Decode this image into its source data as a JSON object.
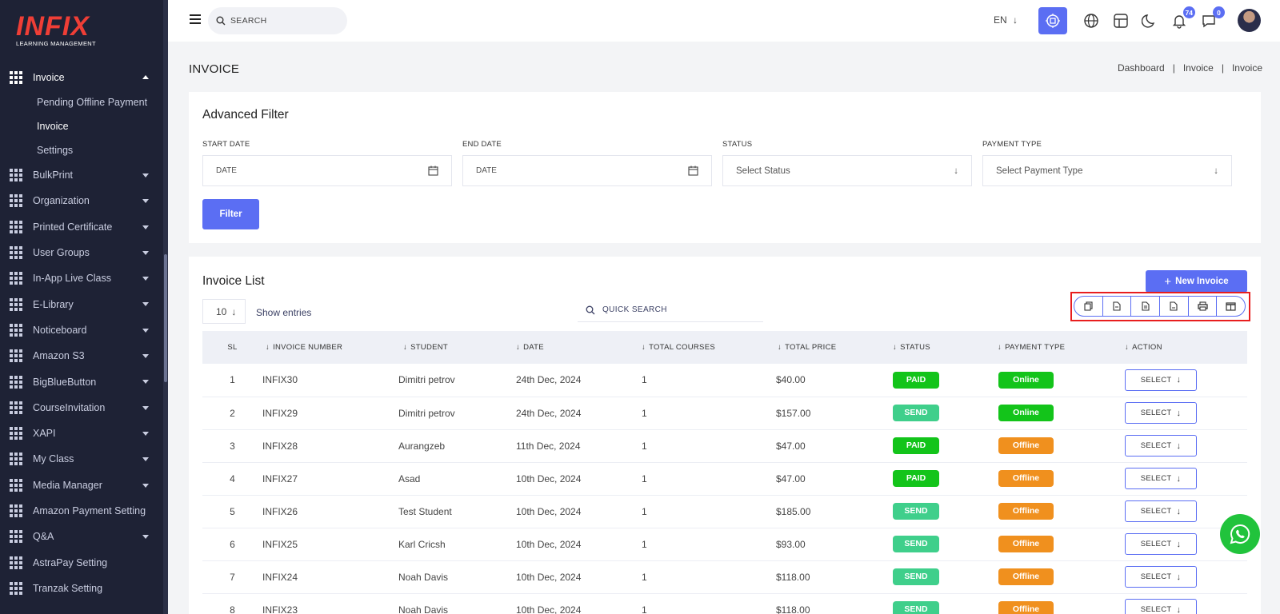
{
  "brand": {
    "name": "INFIX",
    "tagline": "LEARNING MANAGEMENT"
  },
  "sidebar": {
    "active": {
      "label": "Invoice",
      "icon": "grid-icon"
    },
    "submenu": [
      "Pending Offline Payment",
      "Invoice",
      "Settings"
    ],
    "items": [
      {
        "label": "BulkPrint",
        "caret": true
      },
      {
        "label": "Organization",
        "caret": true
      },
      {
        "label": "Printed Certificate",
        "caret": true
      },
      {
        "label": "User Groups",
        "caret": true
      },
      {
        "label": "In-App Live Class",
        "caret": true
      },
      {
        "label": "E-Library",
        "caret": true
      },
      {
        "label": "Noticeboard",
        "caret": true
      },
      {
        "label": "Amazon S3",
        "caret": true
      },
      {
        "label": "BigBlueButton",
        "caret": true
      },
      {
        "label": "CourseInvitation",
        "caret": true
      },
      {
        "label": "XAPI",
        "caret": true
      },
      {
        "label": "My Class",
        "caret": true
      },
      {
        "label": "Media Manager",
        "caret": true
      },
      {
        "label": "Amazon Payment Setting",
        "caret": false
      },
      {
        "label": "Q&A",
        "caret": true
      },
      {
        "label": "AstraPay Setting",
        "caret": false
      },
      {
        "label": "Tranzak Setting",
        "caret": false
      }
    ]
  },
  "header": {
    "search_placeholder": "SEARCH",
    "language": "EN",
    "notifications_count": "74",
    "messages_count": "0"
  },
  "page": {
    "title": "INVOICE",
    "breadcrumb": [
      "Dashboard",
      "Invoice",
      "Invoice"
    ]
  },
  "filter": {
    "title": "Advanced Filter",
    "start_date": {
      "label": "START DATE",
      "placeholder": "DATE"
    },
    "end_date": {
      "label": "END DATE",
      "placeholder": "DATE"
    },
    "status": {
      "label": "STATUS",
      "value": "Select Status"
    },
    "payment_type": {
      "label": "PAYMENT TYPE",
      "value": "Select Payment Type"
    },
    "button": "Filter"
  },
  "list": {
    "title": "Invoice List",
    "new_button": "New Invoice",
    "entries": "10",
    "show_entries": "Show entries",
    "quick_search_placeholder": "QUICK SEARCH",
    "export_icons": [
      "copy-icon",
      "csv-icon",
      "excel-icon",
      "pdf-icon",
      "print-icon",
      "columns-icon"
    ],
    "columns": [
      "SL",
      "INVOICE NUMBER",
      "STUDENT",
      "DATE",
      "TOTAL COURSES",
      "TOTAL PRICE",
      "STATUS",
      "PAYMENT TYPE",
      "ACTION"
    ],
    "action_label": "SELECT",
    "rows": [
      {
        "sl": "1",
        "invoice": "INFIX30",
        "student": "Dimitri petrov",
        "date": "24th Dec, 2024",
        "courses": "1",
        "price": "$40.00",
        "status": "PAID",
        "payment": "Online"
      },
      {
        "sl": "2",
        "invoice": "INFIX29",
        "student": "Dimitri petrov",
        "date": "24th Dec, 2024",
        "courses": "1",
        "price": "$157.00",
        "status": "SEND",
        "payment": "Online"
      },
      {
        "sl": "3",
        "invoice": "INFIX28",
        "student": "Aurangzeb",
        "date": "11th Dec, 2024",
        "courses": "1",
        "price": "$47.00",
        "status": "PAID",
        "payment": "Offline"
      },
      {
        "sl": "4",
        "invoice": "INFIX27",
        "student": "Asad",
        "date": "10th Dec, 2024",
        "courses": "1",
        "price": "$47.00",
        "status": "PAID",
        "payment": "Offline"
      },
      {
        "sl": "5",
        "invoice": "INFIX26",
        "student": "Test Student",
        "date": "10th Dec, 2024",
        "courses": "1",
        "price": "$185.00",
        "status": "SEND",
        "payment": "Offline"
      },
      {
        "sl": "6",
        "invoice": "INFIX25",
        "student": "Karl Cricsh",
        "date": "10th Dec, 2024",
        "courses": "1",
        "price": "$93.00",
        "status": "SEND",
        "payment": "Offline"
      },
      {
        "sl": "7",
        "invoice": "INFIX24",
        "student": "Noah Davis",
        "date": "10th Dec, 2024",
        "courses": "1",
        "price": "$118.00",
        "status": "SEND",
        "payment": "Offline"
      },
      {
        "sl": "8",
        "invoice": "INFIX23",
        "student": "Noah Davis",
        "date": "10th Dec, 2024",
        "courses": "1",
        "price": "$118.00",
        "status": "SEND",
        "payment": "Offline"
      }
    ]
  },
  "colors": {
    "accent": "#5b6ef3",
    "paid": "#13c41a",
    "send": "#3fcf8b",
    "online": "#13c41a",
    "offline": "#f0901e",
    "highlight": "#e81e1e",
    "whatsapp": "#21c33c"
  }
}
